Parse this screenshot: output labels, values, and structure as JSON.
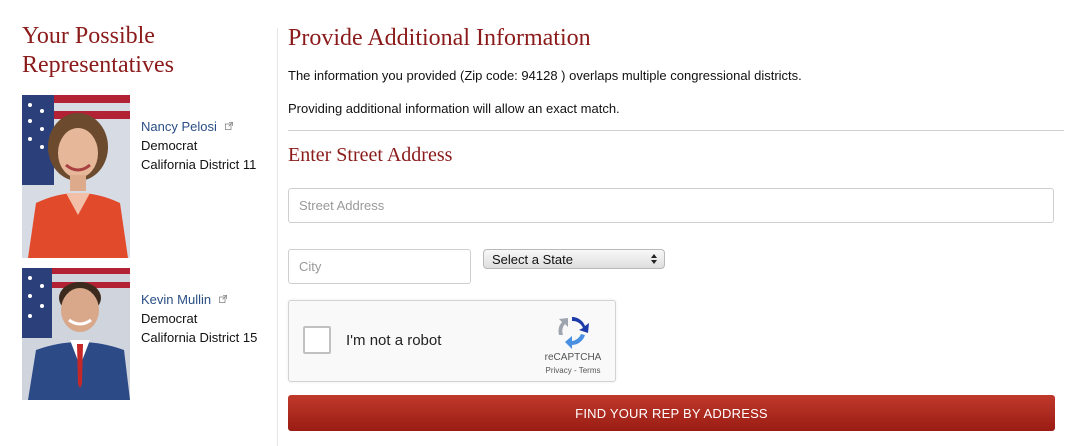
{
  "sidebar": {
    "title": "Your Possible Representatives",
    "reps": [
      {
        "name": "Nancy Pelosi",
        "party": "Democrat",
        "district": "California District 11"
      },
      {
        "name": "Kevin Mullin",
        "party": "Democrat",
        "district": "California District 15"
      }
    ]
  },
  "main": {
    "title": "Provide Additional Information",
    "info_line_1": "The information you provided (Zip code: 94128 ) overlaps multiple congressional districts.",
    "info_line_2": "Providing additional information will allow an exact match.",
    "section_title": "Enter Street Address",
    "form": {
      "street_placeholder": "Street Address",
      "city_placeholder": "City",
      "state_selected": "Select a State",
      "captcha_label": "I'm not a robot",
      "captcha_brand": "reCAPTCHA",
      "captcha_links": "Privacy - Terms",
      "submit_label": "FIND YOUR REP BY ADDRESS"
    }
  },
  "icons": {
    "external_link": "external-link-icon",
    "recaptcha": "recaptcha-logo-icon",
    "select_arrows": "select-arrows-icon"
  },
  "colors": {
    "heading": "#8b1a1a",
    "link": "#2a4f85",
    "button": "#b0281e"
  }
}
